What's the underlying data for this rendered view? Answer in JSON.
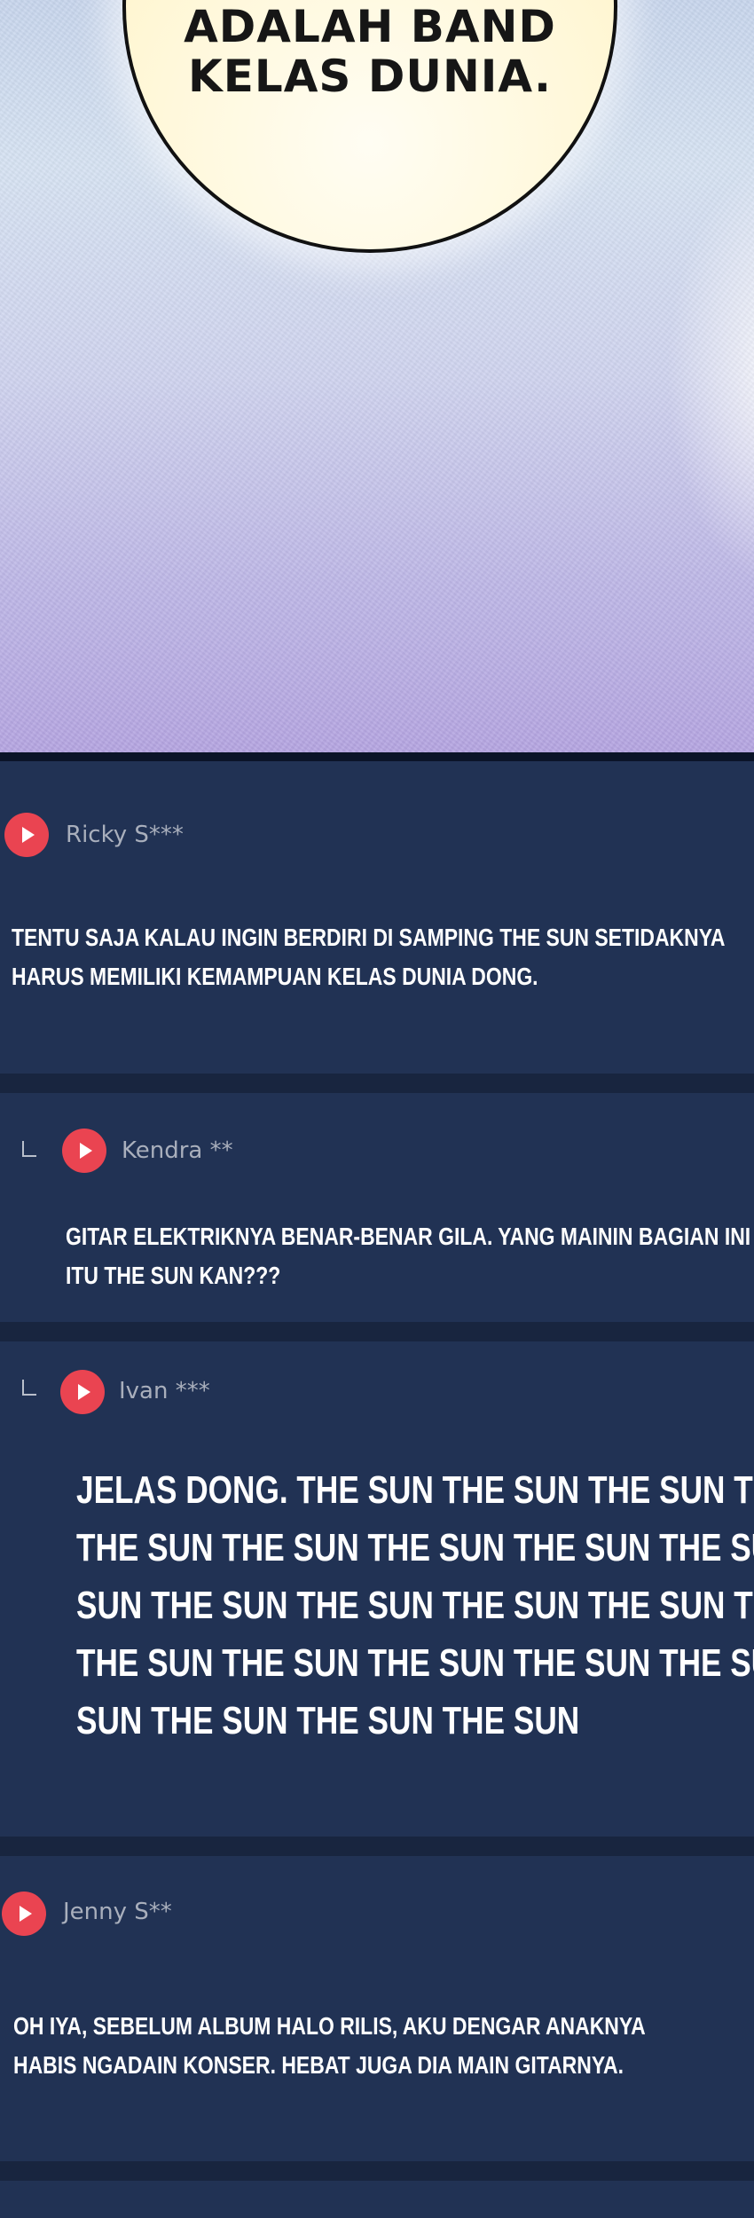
{
  "panel": {
    "bubble_lines": [
      "ADALAH BAND",
      "KELAS DUNIA."
    ]
  },
  "comments": [
    {
      "user": "Ricky S***",
      "reply": false,
      "lines": [
        "TENTU SAJA KALAU INGIN BERDIRI DI SAMPING THE SUN SETIDAKNYA",
        "HARUS MEMILIKI KEMAMPUAN KELAS DUNIA DONG."
      ]
    },
    {
      "user": "Kendra **",
      "reply": true,
      "lines": [
        "GITAR ELEKTRIKNYA BENAR-BENAR GILA. YANG MAININ BAGIAN INI",
        "ITU THE SUN KAN???"
      ]
    },
    {
      "user": "Ivan ***",
      "reply": true,
      "lines": [
        "JELAS DONG. THE SUN THE SUN THE SUN THE SUN",
        "THE SUN THE SUN THE SUN THE SUN THE SUN THE",
        "SUN THE SUN THE SUN THE SUN THE SUN THE SUN",
        "THE SUN THE SUN THE SUN THE SUN THE SUN THE",
        "SUN THE SUN THE SUN THE SUN"
      ]
    },
    {
      "user": "Jenny S**",
      "reply": false,
      "lines": [
        "OH IYA, SEBELUM ALBUM HALO RILIS, AKU DENGAR ANAKNYA",
        "HABIS NGADAIN KONSER. HEBAT JUGA DIA MAIN GITARNYA."
      ]
    }
  ],
  "colors": {
    "card_bg": "#213254",
    "separator": "#18253f",
    "play_button": "#ea4451",
    "username": "#a9afbc",
    "comment_text": "#ffffff"
  }
}
